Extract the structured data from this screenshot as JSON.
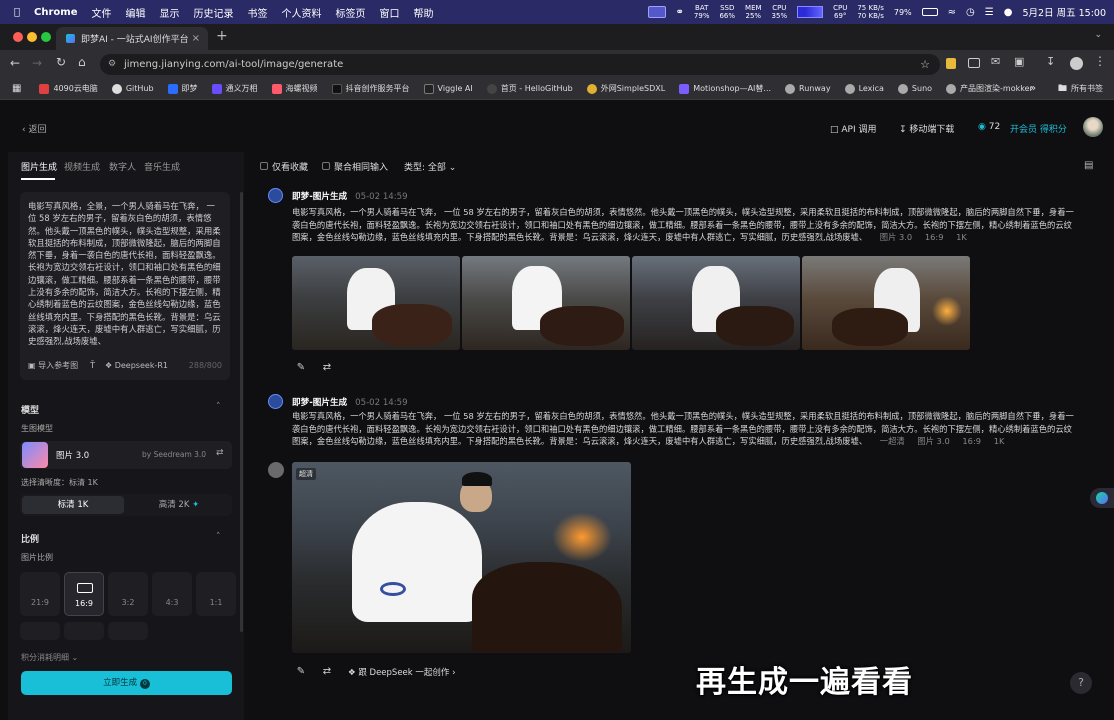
{
  "menubar": {
    "app": "Chrome",
    "items": [
      "文件",
      "编辑",
      "显示",
      "历史记录",
      "书签",
      "个人资料",
      "标签页",
      "窗口",
      "帮助"
    ],
    "stats": [
      {
        "label": "BAT",
        "value": "79%"
      },
      {
        "label": "SSD",
        "value": "66%"
      },
      {
        "label": "MEM",
        "value": "25%"
      },
      {
        "label": "CPU",
        "value": "35%"
      },
      {
        "label": "CPU",
        "value": "69°"
      }
    ],
    "net_up": "75 KB/s",
    "net_down": "70 KB/s",
    "battery": "79%",
    "datetime": "5月2日 周五  15:00"
  },
  "browser": {
    "tab_title": "即梦AI - 一站式AI创作平台",
    "url": "jimeng.jianying.com/ai-tool/image/generate",
    "bookmarks": [
      "4090云电脑",
      "GitHub",
      "即梦",
      "通义万相",
      "海螺视频",
      "抖音创作服务平台",
      "Viggle AI",
      "首页 - HelloGitHub",
      "外网SimpleSDXL",
      "Motionshop—AI替...",
      "Runway",
      "Lexica",
      "Suno",
      "产品图渲染-mokker"
    ],
    "bookmarks_folder": "所有书签"
  },
  "header": {
    "back": "返回",
    "api": "API 调用",
    "download": "移动端下载",
    "points": "72",
    "member": "开会员 得积分"
  },
  "sidebar": {
    "tabs": [
      "图片生成",
      "视频生成",
      "数字人",
      "音乐生成"
    ],
    "prompt": "电影写真风格，全景，一个男人骑着马在飞奔， 一位 58 岁左右的男子，留着灰白色的胡须，表情悠然。他头戴一顶黑色的幞头，幞头造型规整，采用柔软且挺括的布料制成，顶部微微隆起，脑后的两脚自然下垂，身着一袭白色的唐代长袍，面料轻盈飘逸。长袍为宽边交领右衽设计，领口和袖口处有黑色的细边镶滚，做工精细。腰部系着一条黑色的腰带，腰带上没有多余的配饰，简洁大方。长袍的下摆左侧，精心绣制着蓝色的云纹图案，金色丝线勾勒边缘，蓝色丝线填充内里。下身搭配的黑色长靴。背景是：乌云滚滚，烽火连天，废墟中有人群逃亡，写实细腻，历史感强烈,战场废墟、",
    "import_ref": "导入参考图",
    "deepseek": "Deepseek-R1",
    "char_count": "288/800",
    "model_section": "模型",
    "model_label": "生图模型",
    "model_name": "图片 3.0",
    "model_by": "by Seedream 3.0",
    "quality_label": "选择清晰度：标清 1K",
    "quality_options": [
      "标清 1K",
      "高清 2K"
    ],
    "ratio_section": "比例",
    "ratio_label": "图片比例",
    "ratios": [
      "21:9",
      "16:9",
      "3:2",
      "4:3",
      "1:1"
    ],
    "points_detail": "积分消耗明细",
    "generate": "立即生成",
    "generate_cost": "0"
  },
  "main": {
    "filters": [
      "仅看收藏",
      "聚合相同输入",
      "类型: 全部"
    ],
    "blocks": [
      {
        "title": "即梦-图片生成",
        "date": "05-02  14:59",
        "prompt": "电影写真风格，一个男人骑着马在飞奔， 一位 58 岁左右的男子，留着灰白色的胡须，表情悠然。他头戴一顶黑色的幞头，幞头造型规整，采用柔软且挺括的布料制成，顶部微微隆起，脑后的两脚自然下垂，身着一袭白色的唐代长袍，面料轻盈飘逸。长袍为宽边交领右衽设计，领口和袖口处有黑色的细边镶滚，做工精细。腰部系着一条黑色的腰带，腰带上没有多余的配饰，简洁大方。长袍的下摆左侧，精心绣制着蓝色的云纹图案，金色丝线勾勒边缘，蓝色丝线填充内里。下身搭配的黑色长靴。背景是：乌云滚滚，烽火连天，废墟中有人群逃亡，写实细腻，历史感强烈,战场废墟、",
        "meta": [
          "图片 3.0",
          "16:9",
          "1K"
        ]
      },
      {
        "title": "即梦-图片生成",
        "date": "05-02  14:59",
        "prompt": "电影写真风格，一个男人骑着马在飞奔， 一位 58 岁左右的男子，留着灰白色的胡须，表情悠然。他头戴一顶黑色的幞头，幞头造型规整，采用柔软且挺括的布料制成，顶部微微隆起，脑后的两脚自然下垂，身着一袭白色的唐代长袍，面料轻盈飘逸。长袍为宽边交领右衽设计，领口和袖口处有黑色的细边镶滚，做工精细。腰部系着一条黑色的腰带，腰带上没有多余的配饰，简洁大方。长袍的下摆左侧，精心绣制着蓝色的云纹图案，金色丝线勾勒边缘，蓝色丝线填充内里。下身搭配的黑色长靴。背景是：乌云滚滚，烽火连天，废墟中有人群逃亡，写实细腻，历史感强烈,战场废墟、",
        "meta": [
          "一超清",
          "图片 3.0",
          "16:9",
          "1K"
        ],
        "badge": "超清",
        "deepseek": "跟 DeepSeek 一起创作"
      }
    ],
    "subtitle": "再生成一遍看看"
  },
  "colors": {
    "accent": "#19bfd6",
    "menubar": "#2a2a66"
  }
}
